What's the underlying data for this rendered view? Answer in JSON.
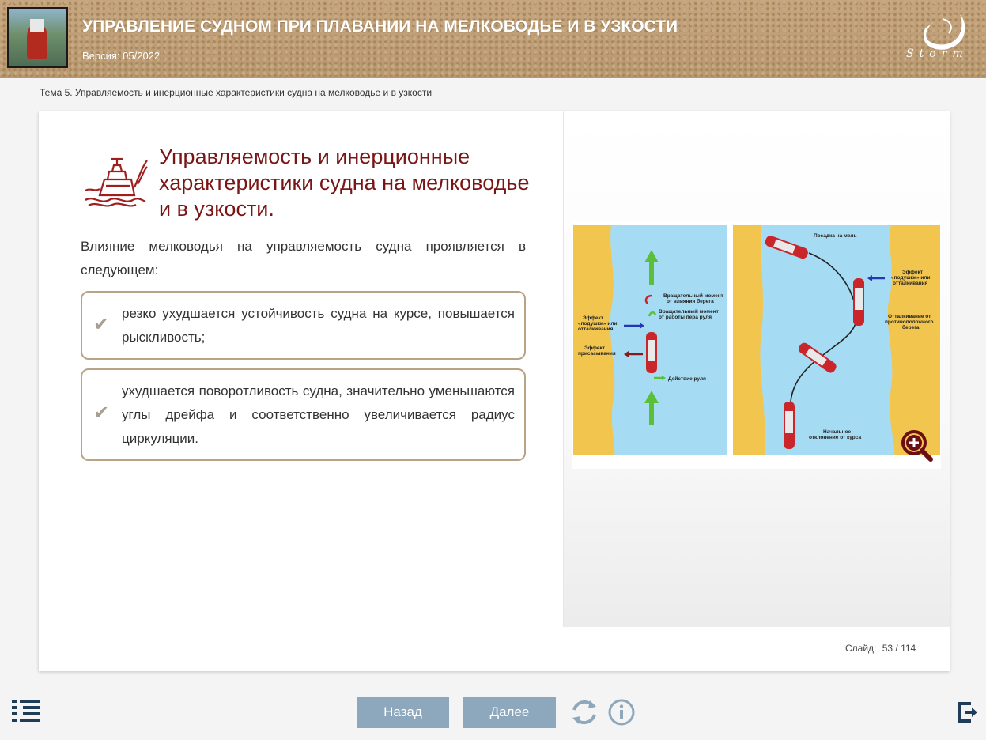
{
  "header": {
    "title": "УПРАВЛЕНИЕ СУДНОМ ПРИ ПЛАВАНИИ НА МЕЛКОВОДЬЕ И В УЗКОСТИ",
    "version": "Версия: 05/2022",
    "logo_text": "Storm"
  },
  "breadcrumb": "Тема 5. Управляемость и инерционные характеристики судна на мелководье и в узкости",
  "slide": {
    "title": "Управляемость и инерционные характеристики судна на мелководье и в узкости.",
    "intro": "Влияние мелководья на управляемость судна проявляется в следующем:",
    "cards": [
      {
        "text": "резко ухудшается устойчивость судна на курсе, повышается рыскливость;"
      },
      {
        "text": "ухудшается поворотливость судна, значительно уменьшаются углы дрейфа и соответственно увеличивается радиус циркуляции."
      }
    ],
    "check_glyph": "✔",
    "counter_label": "Слайд:",
    "counter_value": "53 / 114"
  },
  "diagram": {
    "left": {
      "label_moment_bank": "Вращательный момент от влияния берега",
      "label_moment_rudder": "Вращательный момент от работы пера руля",
      "label_cushion": "Эффект «подушки» или отталкивания",
      "label_suction": "Эффект присасывания",
      "label_rudder": "Действие руля"
    },
    "right": {
      "label_grounding": "Посадка на мель",
      "label_cushion": "Эффект «подушки» или отталкивания",
      "label_repel": "Отталкивание от противоположного берега",
      "label_initial": "Начальное отклонение от курса"
    }
  },
  "nav": {
    "back": "Назад",
    "next": "Далее"
  },
  "colors": {
    "accent": "#7a1515",
    "button": "#8da8bc",
    "card_border": "#b8a387",
    "water": "#a6dcf3",
    "sand": "#f2c64e"
  }
}
